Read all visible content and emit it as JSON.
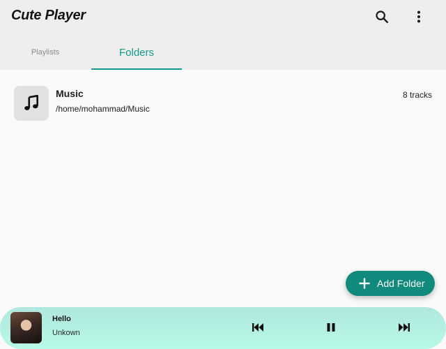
{
  "app": {
    "title": "Cute Player"
  },
  "header": {
    "icons": {
      "search": "search-icon",
      "more": "more-vert-icon"
    }
  },
  "tabs": [
    {
      "label": "Playlists",
      "selected": false
    },
    {
      "label": "Folders",
      "selected": true
    }
  ],
  "folders": [
    {
      "name": "Music",
      "path": "/home/mohammad/Music",
      "count": "8 tracks",
      "icon": "music-note-icon"
    }
  ],
  "fab": {
    "label": "Add Folder",
    "icon": "plus-icon"
  },
  "player": {
    "title": "Hello",
    "artist": "Unkown",
    "state": "playing",
    "icons": {
      "prev": "skip-previous-icon",
      "pause": "pause-icon",
      "next": "skip-next-icon"
    }
  },
  "colors": {
    "accent": "#13998a",
    "fab": "#0f8a7c",
    "header_bg": "#eeeeee",
    "body_bg": "#fafafa",
    "player_bg_top": "#b0e7df",
    "player_bg_bottom": "#b8f9e6"
  }
}
